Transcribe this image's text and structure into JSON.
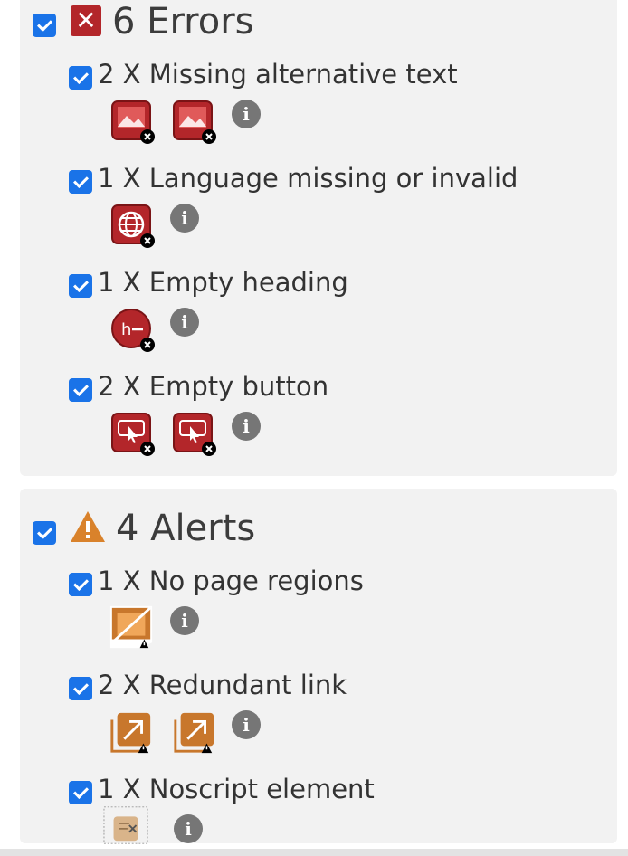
{
  "errors": {
    "title": "6 Errors",
    "icon": "error-x-icon",
    "items": [
      {
        "label": "2 X Missing alternative text",
        "icon": "missing-alt-image-icon",
        "count": 2
      },
      {
        "label": "1 X Language missing or invalid",
        "icon": "language-globe-icon",
        "count": 1
      },
      {
        "label": "1 X Empty heading",
        "icon": "empty-heading-icon",
        "count": 1
      },
      {
        "label": "2 X Empty button",
        "icon": "empty-button-icon",
        "count": 2
      }
    ]
  },
  "alerts": {
    "title": "4 Alerts",
    "icon": "warning-triangle-icon",
    "items": [
      {
        "label": "1 X No page regions",
        "icon": "no-page-regions-icon",
        "count": 1
      },
      {
        "label": "2 X Redundant link",
        "icon": "redundant-link-icon",
        "count": 2
      },
      {
        "label": "1 X Noscript element",
        "icon": "noscript-element-icon",
        "count": 1
      }
    ]
  },
  "colors": {
    "error_red": "#b3262a",
    "alert_orange": "#d9822b",
    "checkbox_blue": "#1a73e8",
    "info_gray": "#767676"
  }
}
